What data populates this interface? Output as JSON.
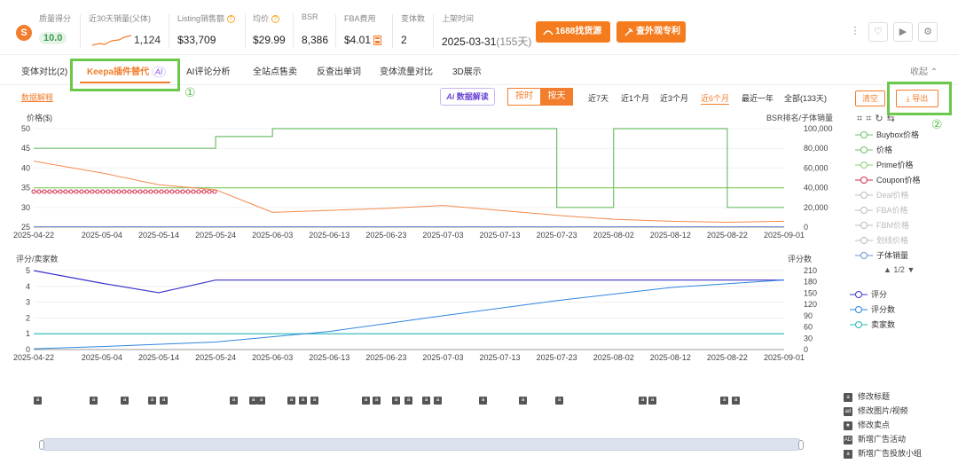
{
  "stats": {
    "quality": {
      "label": "质量得分",
      "value": "10.0"
    },
    "sales30": {
      "label": "近30天销量(父体)",
      "value": "1,124"
    },
    "listing": {
      "label": "Listing销售额",
      "value": "$33,709"
    },
    "avg": {
      "label": "均价",
      "value": "$29.99"
    },
    "bsr": {
      "label": "BSR",
      "value": "8,386"
    },
    "fba": {
      "label": "FBA费用",
      "value": "$4.01"
    },
    "variants": {
      "label": "变体数",
      "value": "2"
    },
    "launch": {
      "label": "上架时间",
      "value": "2025-03-31",
      "days": "(155天)"
    },
    "btn_1688": "1688找货源",
    "btn_patent": "查外观专利"
  },
  "tabs": [
    "变体对比(2)",
    "Keepa插件替代",
    "AI评论分析",
    "全站点售卖",
    "反查出单词",
    "变体流量对比",
    "3D展示"
  ],
  "collapse": "收起",
  "ai_tag": "AI",
  "annotations": {
    "one": "①",
    "two": "②"
  },
  "toolbar": {
    "data_explain": "数据解释",
    "ai_read": "数据解读",
    "by_time": "按时",
    "by_day": "按天",
    "ranges": [
      "近7天",
      "近1个月",
      "近3个月",
      "近6个月",
      "最近一年",
      "全部(133天)"
    ],
    "active_range": "近6个月",
    "clear": "清空",
    "export": "导出"
  },
  "dates": [
    "2025-04-22",
    "2025-05-04",
    "2025-05-14",
    "2025-05-24",
    "2025-06-03",
    "2025-06-13",
    "2025-06-23",
    "2025-07-03",
    "2025-07-13",
    "2025-07-23",
    "2025-08-02",
    "2025-08-12",
    "2025-08-22",
    "2025-09-01"
  ],
  "chart_data": [
    {
      "type": "line",
      "ylabel": "价格($)",
      "ylabel_right": "BSR排名/子体销量",
      "yticks": [
        25,
        30,
        35,
        40,
        45,
        50
      ],
      "yticks_right": [
        "0",
        "20,000",
        "40,000",
        "60,000",
        "80,000",
        "100,000"
      ],
      "ylim": [
        25,
        50
      ],
      "ylim_right": [
        0,
        100000
      ],
      "series": [
        {
          "name": "Coupon价格",
          "color": "#d62a4a",
          "x": [
            "2025-04-22",
            "2025-05-24"
          ],
          "y": [
            34,
            34
          ]
        },
        {
          "name": "Prime价格",
          "color": "#8ccf6a",
          "x": [
            "2025-04-22",
            "2025-05-24",
            "2025-07-13",
            "2025-09-01"
          ],
          "y": [
            35,
            35,
            35,
            35
          ]
        }
      ],
      "right_series": [
        {
          "name": "BSR",
          "color": "#f28a4e",
          "x": [
            "2025-04-22",
            "2025-05-04",
            "2025-05-14",
            "2025-05-24",
            "2025-06-03",
            "2025-06-13",
            "2025-06-23",
            "2025-07-03",
            "2025-07-13",
            "2025-07-23",
            "2025-08-02",
            "2025-08-12",
            "2025-08-22",
            "2025-09-01"
          ],
          "y": [
            67000,
            55000,
            43000,
            38000,
            15000,
            17000,
            19000,
            22000,
            17000,
            12000,
            8000,
            6000,
            5000,
            6000
          ]
        },
        {
          "name": "子体销量",
          "color": "#7a8cdb",
          "x": [
            "2025-04-22",
            "2025-09-01"
          ],
          "y": [
            500,
            500
          ]
        }
      ],
      "legend": [
        "Buybox价格",
        "价格",
        "Prime价格",
        "Coupon价格",
        "Deal价格",
        "FBA价格",
        "FBM价格",
        "划线价格",
        "子体销量"
      ],
      "legend_colors": [
        "#6fbf6a",
        "#6fbf6a",
        "#8ccf6a",
        "#d62a4a",
        "#bbb",
        "#bbb",
        "#bbb",
        "#bbb",
        "#6c8fd8"
      ],
      "legend_page": "1/2"
    },
    {
      "type": "line",
      "ylabel": "评分/卖家数",
      "ylabel_right": "评分数",
      "yticks": [
        0,
        1,
        2,
        3,
        4,
        5
      ],
      "yticks_right": [
        0,
        30,
        60,
        90,
        120,
        150,
        180,
        210
      ],
      "ylim": [
        0,
        5
      ],
      "ylim_right": [
        0,
        210
      ],
      "series": [
        {
          "name": "评分",
          "color": "#3b34c9",
          "x": [
            "2025-04-22",
            "2025-05-04",
            "2025-05-14",
            "2025-05-24",
            "2025-06-13",
            "2025-07-13",
            "2025-08-12",
            "2025-09-01"
          ],
          "y": [
            5,
            4.2,
            3.6,
            4.4,
            4.4,
            4.4,
            4.4,
            4.4
          ]
        },
        {
          "name": "卖家数",
          "color": "#24b8b0",
          "x": [
            "2025-04-22",
            "2025-09-01"
          ],
          "y": [
            1,
            1
          ]
        }
      ],
      "right_series": [
        {
          "name": "评分数",
          "color": "#2e86de",
          "x": [
            "2025-04-22",
            "2025-05-04",
            "2025-05-24",
            "2025-06-13",
            "2025-07-03",
            "2025-07-23",
            "2025-08-12",
            "2025-09-01"
          ],
          "y": [
            2,
            8,
            20,
            48,
            90,
            130,
            165,
            185
          ]
        }
      ]
    }
  ],
  "events_legend": [
    "修改标题",
    "修改图片/视频",
    "修改卖点",
    "新增广告活动",
    "新增广告投放小组"
  ],
  "events_marks": [
    "a",
    "ad",
    "★",
    "AD",
    "a"
  ]
}
